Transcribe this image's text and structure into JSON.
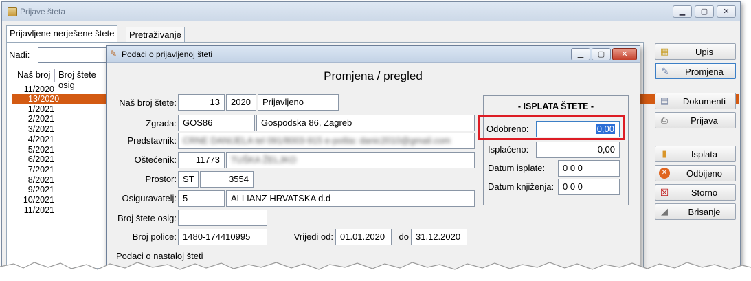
{
  "main_window": {
    "title": "Prijave šteta",
    "tabs": [
      {
        "label": "Prijavljene nerješene štete",
        "active": true
      },
      {
        "label": "Pretraživanje",
        "active": false
      }
    ],
    "find_label": "Nađi:",
    "list": {
      "headers": [
        "Naš broj",
        "Broj štete osig"
      ],
      "rows": [
        "11/2020",
        "13/2020",
        "1/2021",
        "2/2021",
        "3/2021",
        "4/2021",
        "5/2021",
        "6/2021",
        "7/2021",
        "8/2021",
        "9/2021",
        "10/2021",
        "11/2021"
      ],
      "selected_index": 1
    },
    "buttons": [
      {
        "label": "Upis",
        "icon": "upis-icon"
      },
      {
        "label": "Promjena",
        "icon": "promjena-icon"
      },
      {
        "label": "Dokumenti",
        "icon": "documents-icon"
      },
      {
        "label": "Prijava",
        "icon": "printer-icon"
      },
      {
        "label": "Isplata",
        "icon": "payment-icon"
      },
      {
        "label": "Odbijeno",
        "icon": "reject-icon"
      },
      {
        "label": "Storno",
        "icon": "storno-icon"
      },
      {
        "label": "Brisanje",
        "icon": "eraser-icon"
      }
    ]
  },
  "dialog": {
    "title": "Podaci o prijavljenoj šteti",
    "heading": "Promjena / pregled",
    "fields": {
      "nas_broj_label": "Naš broj štete:",
      "nas_broj_num": "13",
      "nas_broj_year": "2020",
      "status": "Prijavljeno",
      "zgrada_label": "Zgrada:",
      "zgrada_code": "GOS86",
      "zgrada_name": "Gospodska 86, Zagreb",
      "predstavnik_label": "Predstavnik:",
      "predstavnik_value": "CRNE DANIJELA tel 091/8003-915 e-pošta: danic2010@gmail.com",
      "ostecenik_label": "Oštećenik:",
      "ostecenik_id": "11773",
      "ostecenik_name": "TUŠKA ŽELJKO",
      "prostor_label": "Prostor:",
      "prostor_code": "ST",
      "prostor_num": "3554",
      "osiguravatelj_label": "Osiguravatelj:",
      "osiguravatelj_code": "5",
      "osiguravatelj_name": "ALLIANZ HRVATSKA d.d",
      "broj_stete_osig_label": "Broj štete osig:",
      "broj_stete_osig_value": "",
      "broj_police_label": "Broj police:",
      "broj_police_value": "1480-174410995",
      "vrijedi_od_label": "Vrijedi od:",
      "vrijedi_od_value": "01.01.2020",
      "do_label": "do",
      "do_value": "31.12.2020",
      "bottom_label": "Podaci o nastaloj šteti"
    },
    "payout": {
      "title": "- ISPLATA ŠTETE -",
      "odobreno_label": "Odobreno:",
      "odobreno_value": "0,00",
      "isplaceno_label": "Isplaćeno:",
      "isplaceno_value": "0,00",
      "datum_isplate_label": "Datum isplate:",
      "datum_isplate_value": "0 0  0",
      "datum_knjizenja_label": "Datum knjiženja:",
      "datum_knjizenja_value": "0 0  0"
    }
  },
  "colors": {
    "selected_row": "#d35a12",
    "highlight_box": "#dd1c24",
    "focus_border": "#3c7fc6"
  }
}
